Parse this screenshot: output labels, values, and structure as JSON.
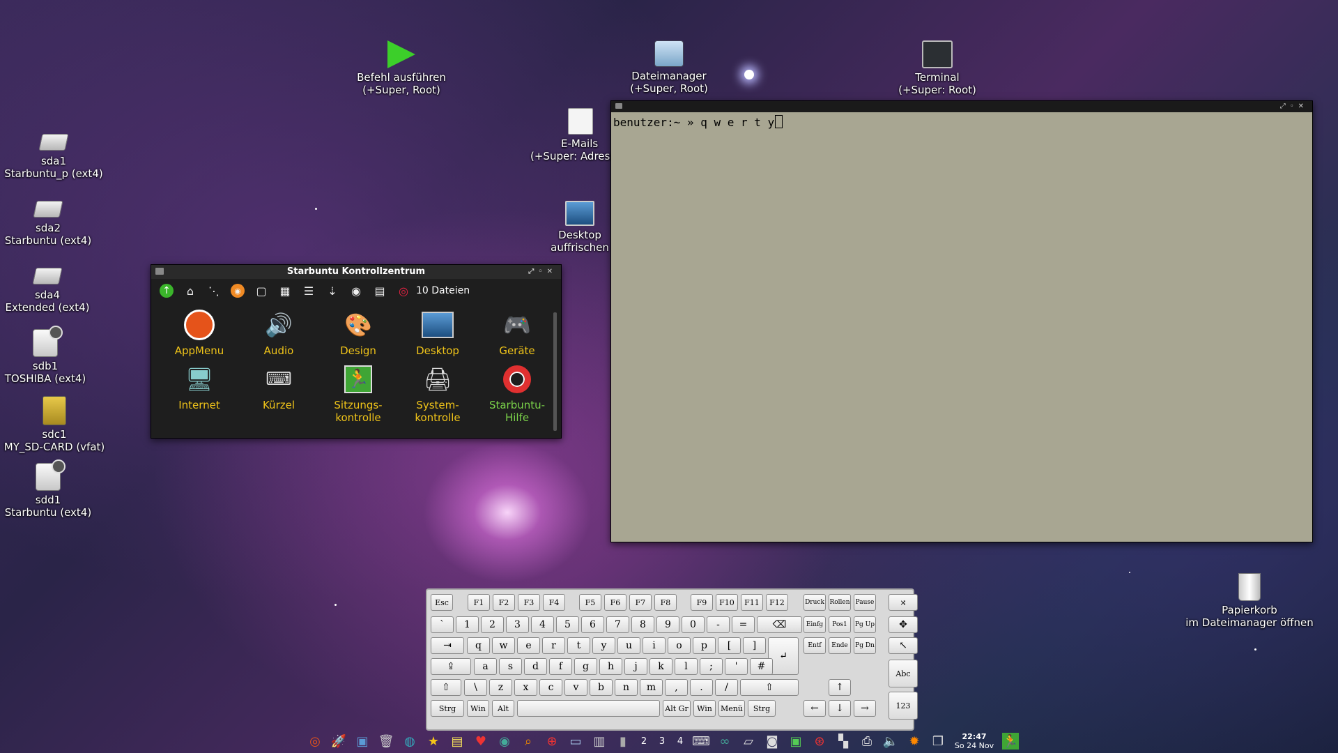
{
  "desktop": {
    "top_icons": [
      {
        "label1": "Befehl ausführen",
        "label2": "(+Super, Root)"
      },
      {
        "label1": "Dateimanager",
        "label2": "(+Super, Root)"
      },
      {
        "label1": "Terminal",
        "label2": "(+Super: Root)"
      }
    ],
    "email": {
      "label1": "E-Mails",
      "label2": "(+Super: Adress"
    },
    "refresh": {
      "label1": "Desktop",
      "label2": "auffrischen"
    },
    "drives": [
      {
        "name": "sda1",
        "desc": "Starbuntu_p (ext4)"
      },
      {
        "name": "sda2",
        "desc": "Starbuntu (ext4)"
      },
      {
        "name": "sda4",
        "desc": "Extended (ext4)"
      },
      {
        "name": "sdb1",
        "desc": "TOSHIBA (ext4)"
      },
      {
        "name": "sdc1",
        "desc": "MY_SD-CARD (vfat)"
      },
      {
        "name": "sdd1",
        "desc": "Starbuntu (ext4)"
      }
    ],
    "trash": {
      "label1": "Papierkorb",
      "label2": "im Dateimanager öffnen"
    }
  },
  "control_center": {
    "title": "Starbuntu Kontrollzentrum",
    "file_count": "10 Dateien",
    "items": [
      {
        "label": "AppMenu",
        "label2": ""
      },
      {
        "label": "Audio",
        "label2": ""
      },
      {
        "label": "Design",
        "label2": ""
      },
      {
        "label": "Desktop",
        "label2": ""
      },
      {
        "label": "Geräte",
        "label2": ""
      },
      {
        "label": "Internet",
        "label2": ""
      },
      {
        "label": "Kürzel",
        "label2": ""
      },
      {
        "label": "Sitzungs-",
        "label2": "kontrolle"
      },
      {
        "label": "System-",
        "label2": "kontrolle"
      },
      {
        "label": "Starbuntu-Hilfe",
        "label2": ""
      }
    ]
  },
  "terminal": {
    "prompt": "benutzer:~ » ",
    "input": "q w e r t y"
  },
  "keyboard": {
    "row_fn": [
      "Esc",
      "F1",
      "F2",
      "F3",
      "F4",
      "F5",
      "F6",
      "F7",
      "F8",
      "F9",
      "F10",
      "F11",
      "F12",
      "Druck",
      "Rollen",
      "Pause",
      "⤨"
    ],
    "row_num": [
      "`",
      "1",
      "2",
      "3",
      "4",
      "5",
      "6",
      "7",
      "8",
      "9",
      "0",
      "-",
      "=",
      "⌫",
      "Einfg",
      "Pos1",
      "Pg Up",
      "✥"
    ],
    "row_q": [
      "⇥",
      "q",
      "w",
      "e",
      "r",
      "t",
      "y",
      "u",
      "i",
      "o",
      "p",
      "[",
      "]",
      "↵",
      "Entf",
      "Ende",
      "Pg Dn",
      "↖"
    ],
    "row_a": [
      "⇪",
      "a",
      "s",
      "d",
      "f",
      "g",
      "h",
      "j",
      "k",
      "l",
      ";",
      "'",
      "#"
    ],
    "row_z": [
      "⇧",
      "\\",
      "z",
      "x",
      "c",
      "v",
      "b",
      "n",
      "m",
      ",",
      ".",
      "/",
      "⇧",
      "↑"
    ],
    "row_bottom": [
      "Strg",
      "Win",
      "Alt",
      "Alt Gr",
      "Win",
      "Menü",
      "Strg",
      "←",
      "↓",
      "→"
    ],
    "side": [
      "Abc",
      "123"
    ]
  },
  "taskbar": {
    "workspaces": [
      "2",
      "3",
      "4"
    ],
    "time": "22:47",
    "date": "So 24 Nov"
  }
}
